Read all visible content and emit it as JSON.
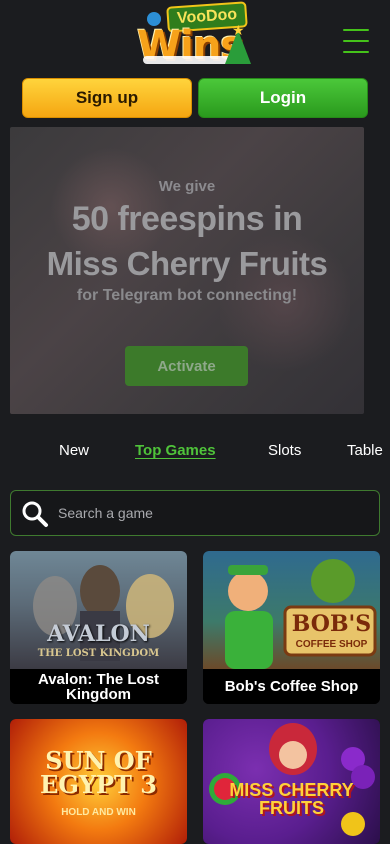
{
  "header": {
    "logo_top": "VooDoo",
    "logo_main": "Wins",
    "signup_label": "Sign up",
    "login_label": "Login"
  },
  "banner": {
    "line1": "We give",
    "line2": "50 freespins in",
    "line3": "Miss Cherry Fruits",
    "line4": "for Telegram bot connecting!",
    "button_label": "Activate"
  },
  "tabs": [
    {
      "label": "New",
      "active": false
    },
    {
      "label": "Top Games",
      "active": true
    },
    {
      "label": "Slots",
      "active": false
    },
    {
      "label": "Table",
      "active": false
    }
  ],
  "search": {
    "placeholder": "Search a game"
  },
  "games": [
    {
      "title": "Avalon: The Lost Kingdom",
      "art_title": "AVALON",
      "art_sub": "THE LOST KINGDOM"
    },
    {
      "title": "Bob's Coffee Shop",
      "art_title": "BOB'S",
      "art_sub": "COFFEE SHOP"
    },
    {
      "title": "",
      "art_title": "SUN OF EGYPT 3",
      "art_sub": "HOLD AND WIN"
    },
    {
      "title": "",
      "art_title": "MISS CHERRY FRUITS",
      "art_sub": ""
    }
  ],
  "colors": {
    "accent_green": "#4fc33a",
    "signup_yellow": "#ffc62a",
    "background": "#1b1c1f"
  },
  "icons": {
    "menu": "hamburger-icon",
    "search": "magnifier-icon"
  }
}
